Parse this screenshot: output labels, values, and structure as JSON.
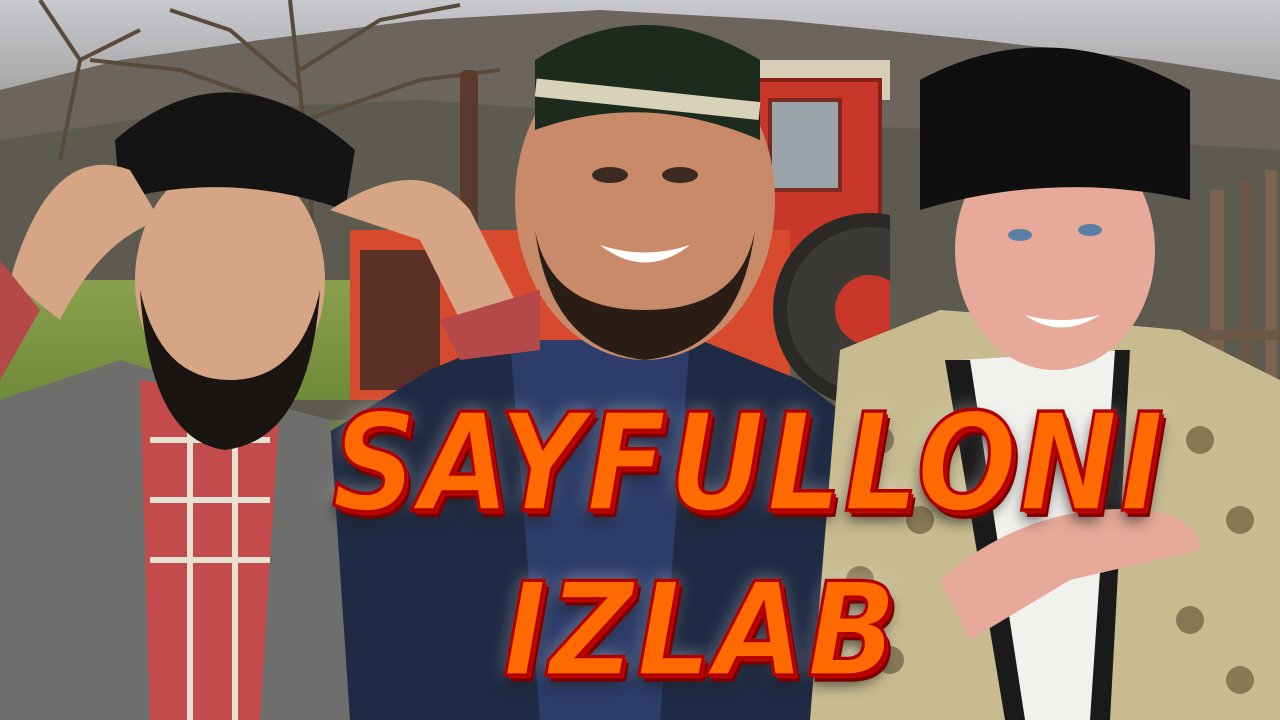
{
  "title": {
    "line1": "SAYFULLONI",
    "line2": "IZLAB"
  },
  "colors": {
    "title_fill": "#ff6a00",
    "title_outline": "#b10000",
    "tractor": "#d9452b",
    "grass": "#7a9443"
  },
  "figures": [
    {
      "name": "left-man",
      "hat": "black flat cap",
      "beard": "black",
      "shirt": "red plaid",
      "jacket": "grey"
    },
    {
      "name": "center-man",
      "hat": "embroidered skullcap",
      "shirt": "navy",
      "jacket": "dark pinstripe"
    },
    {
      "name": "right-man",
      "hat": "black fur hat",
      "shirt": "white striped",
      "jacket": "patterned brocade"
    }
  ]
}
